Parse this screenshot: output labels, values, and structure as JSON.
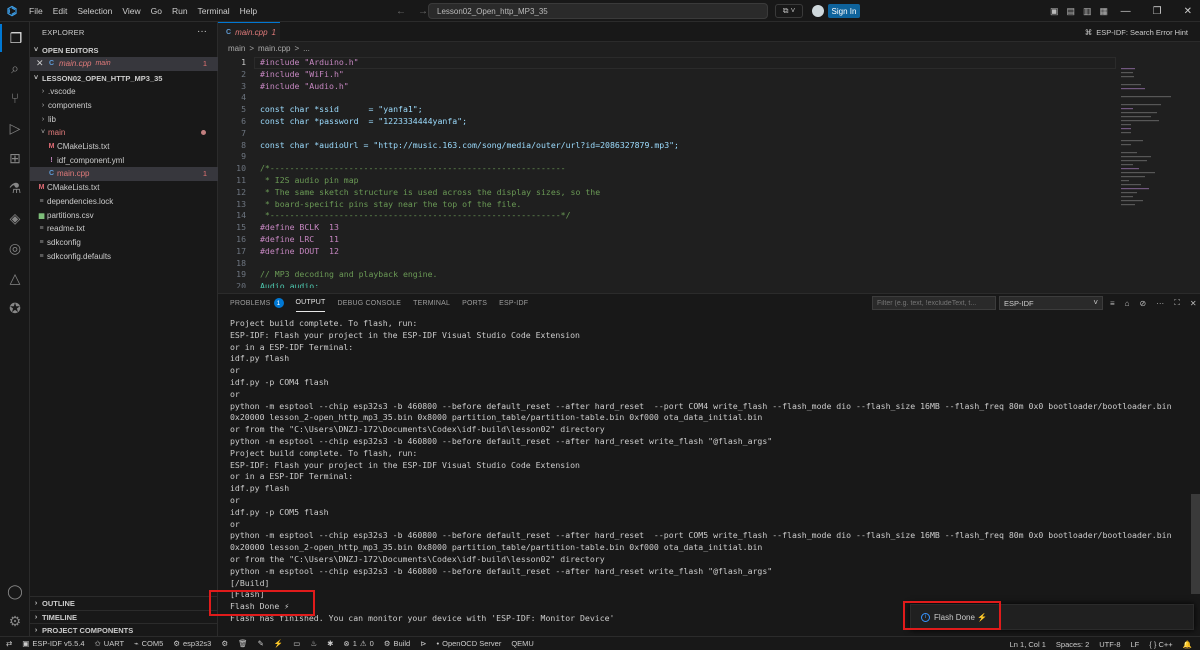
{
  "menu": [
    "File",
    "Edit",
    "Selection",
    "View",
    "Go",
    "Run",
    "Terminal",
    "Help"
  ],
  "title_search": "Lesson02_Open_http_MP3_35",
  "sign_in": "Sign In",
  "sidebar": {
    "title": "EXPLORER",
    "open_editors_label": "OPEN EDITORS",
    "open_editor": {
      "name": "main.cpp",
      "folder": "main",
      "problems": "1"
    },
    "project_label": "LESSON02_OPEN_HTTP_MP3_35",
    "tree": [
      {
        "name": ".vscode",
        "kind": "folder"
      },
      {
        "name": "components",
        "kind": "folder"
      },
      {
        "name": "lib",
        "kind": "folder"
      },
      {
        "name": "main",
        "kind": "folder-open"
      },
      {
        "name": "CMakeLists.txt",
        "kind": "file"
      },
      {
        "name": "idf_component.yml",
        "kind": "file"
      },
      {
        "name": "main.cpp",
        "kind": "file",
        "problems": "1"
      },
      {
        "name": "CMakeLists.txt",
        "kind": "file"
      },
      {
        "name": "dependencies.lock",
        "kind": "file"
      },
      {
        "name": "partitions.csv",
        "kind": "file"
      },
      {
        "name": "readme.txt",
        "kind": "file"
      },
      {
        "name": "sdkconfig",
        "kind": "file"
      },
      {
        "name": "sdkconfig.defaults",
        "kind": "file"
      }
    ],
    "bottom_sections": [
      "OUTLINE",
      "TIMELINE",
      "PROJECT COMPONENTS"
    ]
  },
  "editor": {
    "tab_label": "main.cpp",
    "tab_badge": "1",
    "hint": "ESP-IDF: Search Error Hint",
    "breadcrumb": [
      "main",
      ">",
      "main.cpp",
      ">",
      "..."
    ],
    "lines": [
      "#include \"Arduino.h\"",
      "#include \"WiFi.h\"",
      "#include \"Audio.h\"",
      "",
      "const char *ssid      = \"yanfa1\";",
      "const char *password  = \"1223334444yanfa\";",
      "",
      "const char *audioUrl = \"http://music.163.com/song/media/outer/url?id=2086327879.mp3\";",
      "",
      "/*------------------------------------------------------------",
      " * I2S audio pin map",
      " * The same sketch structure is used across the display sizes, so the",
      " * board-specific pins stay near the top of the file.",
      " *-----------------------------------------------------------*/",
      "#define BCLK  13",
      "#define LRC   11",
      "#define DOUT  12",
      "",
      "// MP3 decoding and playback engine.",
      "Audio audio;"
    ]
  },
  "panel": {
    "tabs": [
      "PROBLEMS",
      "OUTPUT",
      "DEBUG CONSOLE",
      "TERMINAL",
      "PORTS",
      "ESP-IDF"
    ],
    "problems_count": "1",
    "filter_placeholder": "Filter (e.g. text, !excludeText, t...",
    "channel": "ESP-IDF",
    "output_lines": [
      "Project build complete. To flash, run:",
      "ESP-IDF: Flash your project in the ESP-IDF Visual Studio Code Extension",
      "or in a ESP-IDF Terminal:",
      "idf.py flash",
      "or",
      "idf.py -p COM4 flash",
      "or",
      "python -m esptool --chip esp32s3 -b 460800 --before default_reset --after hard_reset  --port COM4 write_flash --flash_mode dio --flash_size 16MB --flash_freq 80m 0x0 bootloader/bootloader.bin",
      "0x20000 lesson_2-open_http_mp3_35.bin 0x8000 partition_table/partition-table.bin 0xf000 ota_data_initial.bin",
      "or from the \"C:\\Users\\DNZJ-172\\Documents\\Codex\\idf-build\\lesson02\" directory",
      "python -m esptool --chip esp32s3 -b 460800 --before default_reset --after hard_reset write_flash \"@flash_args\"",
      "Project build complete. To flash, run:",
      "ESP-IDF: Flash your project in the ESP-IDF Visual Studio Code Extension",
      "or in a ESP-IDF Terminal:",
      "idf.py flash",
      "or",
      "idf.py -p COM5 flash",
      "or",
      "python -m esptool --chip esp32s3 -b 460800 --before default_reset --after hard_reset  --port COM5 write_flash --flash_mode dio --flash_size 16MB --flash_freq 80m 0x0 bootloader/bootloader.bin",
      "0x20000 lesson_2-open_http_mp3_35.bin 0x8000 partition_table/partition-table.bin 0xf000 ota_data_initial.bin",
      "or from the \"C:\\Users\\DNZJ-172\\Documents\\Codex\\idf-build\\lesson02\" directory",
      "python -m esptool --chip esp32s3 -b 460800 --before default_reset --after hard_reset write_flash \"@flash_args\"",
      "[/Build]",
      "[Flash]",
      "Flash Done ⚡",
      "Flash has finished. You can monitor your device with 'ESP-IDF: Monitor Device'"
    ]
  },
  "toast": {
    "text": "Flash Done ⚡"
  },
  "status": {
    "idf_version": "ESP-IDF v5.5.4",
    "uart": "UART",
    "port": "COM5",
    "target": "esp32s3",
    "errors": "1",
    "warnings": "0",
    "build": "Build",
    "openocd": "OpenOCD Server",
    "qemu": "QEMU",
    "cursor": "Ln 1, Col 1",
    "spaces": "Spaces: 2",
    "encoding": "UTF-8",
    "eol": "LF",
    "language": "C++"
  }
}
